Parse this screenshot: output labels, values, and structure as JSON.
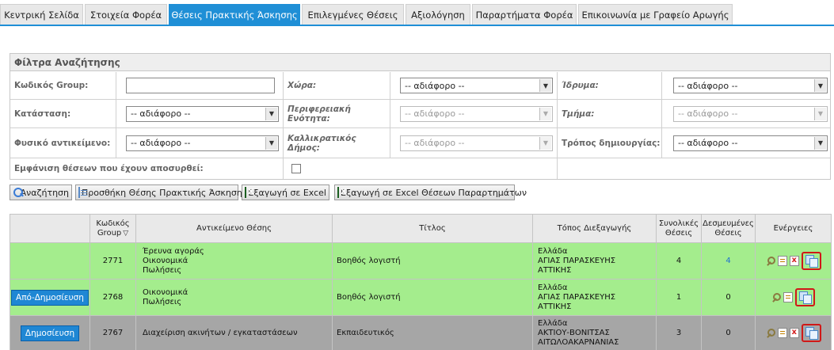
{
  "tabs": [
    {
      "label": "Κεντρική Σελίδα",
      "active": false
    },
    {
      "label": "Στοιχεία Φορέα",
      "active": false
    },
    {
      "label": "Θέσεις Πρακτικής Άσκησης",
      "active": true
    },
    {
      "label": "Επιλεγμένες Θέσεις",
      "active": false
    },
    {
      "label": "Αξιολόγηση",
      "active": false
    },
    {
      "label": "Παραρτήματα Φορέα",
      "active": false
    },
    {
      "label": "Επικοινωνία με Γραφείο Αρωγής",
      "active": false
    }
  ],
  "filters": {
    "title": "Φίλτρα Αναζήτησης",
    "group_code_label": "Κωδικός Group:",
    "group_code_value": "",
    "country_label": "Χώρα:",
    "country_value": "-- αδιάφορο --",
    "institution_label": "Ίδρυμα:",
    "institution_value": "-- αδιάφορο --",
    "status_label": "Κατάσταση:",
    "status_value": "-- αδιάφορο --",
    "region_label": "Περιφερειακή Ενότητα:",
    "region_value": "-- αδιάφορο --",
    "department_label": "Τμήμα:",
    "department_value": "-- αδιάφορο --",
    "physical_object_label": "Φυσικό αντικείμενο:",
    "physical_object_value": "-- αδιάφορο --",
    "municipality_label": "Καλλικρατικός Δήμος:",
    "municipality_value": "-- αδιάφορο --",
    "creation_method_label": "Τρόπος δημιουργίας:",
    "creation_method_value": "-- αδιάφορο --",
    "show_withdrawn_label": "Εμφάνιση θέσεων που έχουν αποσυρθεί:",
    "show_withdrawn_checked": false
  },
  "actions": {
    "search_label": "Αναζήτηση",
    "add_position_label": "Προσθήκη Θέσης Πρακτικής Άσκησης",
    "export_excel_label": "Εξαγωγή σε Excel",
    "export_excel_branches_label": "Εξαγωγή σε Excel Θέσεων Παραρτημάτων"
  },
  "table": {
    "headers": {
      "group_code": "Κωδικός Group",
      "subject": "Αντικείμενο Θέσης",
      "title": "Τίτλος",
      "location": "Τόπος Διεξαγωγής",
      "total": "Συνολικές Θέσεις",
      "reserved": "Δεσμευμένες Θέσεις",
      "actions": "Ενέργειες"
    },
    "rows": [
      {
        "publish_button": "",
        "group_code": "2771",
        "subject": [
          "Έρευνα αγοράς",
          "Οικονομικά",
          "Πωλήσεις"
        ],
        "title": "Βοηθός λογιστή",
        "location": [
          "Ελλάδα",
          "ΑΓΙΑΣ ΠΑΡΑΣΚΕΥΗΣ",
          "ΑΤΤΙΚΗΣ"
        ],
        "total": "4",
        "reserved": "4",
        "color": "#a4ed8d"
      },
      {
        "publish_button": "Από-Δημοσίευση",
        "group_code": "2768",
        "subject": [
          "Οικονομικά",
          "Πωλήσεις"
        ],
        "title": "Βοηθός λογιστή",
        "location": [
          "Ελλάδα",
          "ΑΓΙΑΣ ΠΑΡΑΣΚΕΥΗΣ",
          "ΑΤΤΙΚΗΣ"
        ],
        "total": "1",
        "reserved": "0",
        "color": "#a4ed8d"
      },
      {
        "publish_button": "Δημοσίευση",
        "group_code": "2767",
        "subject": [
          "Διαχείριση ακινήτων / εγκαταστάσεων"
        ],
        "title": "Εκπαιδευτικός",
        "location": [
          "Ελλάδα",
          "ΑΚΤΙΟΥ-ΒΟΝΙΤΣΑΣ",
          "ΑΙΤΩΛΟΑΚΑΡΝΑΝΙΑΣ"
        ],
        "total": "3",
        "reserved": "0",
        "color": "#a6a6a6"
      }
    ]
  },
  "colors": {
    "accent": "#1f8fd6",
    "published_row": "#a4ed8d",
    "unpublished_row": "#a6a6a6",
    "highlight_box": "#d01818"
  }
}
